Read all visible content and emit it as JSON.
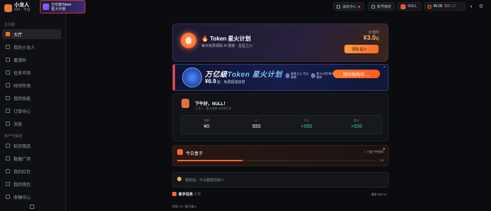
{
  "sidebar": {
    "brand_name": "小龙人",
    "brand_sub": "#24 · 平台",
    "promo_line1": "万亿级Token",
    "promo_line2": "星火计划",
    "section_main": "主功能",
    "section_assets": "资产与渠道",
    "items": [
      {
        "label": "大厅"
      },
      {
        "label": "我的小龙人"
      },
      {
        "label": "邀请码"
      },
      {
        "label": "任务市场"
      },
      {
        "label": "时间市场"
      },
      {
        "label": "我的技能"
      },
      {
        "label": "订单中心"
      },
      {
        "label": "消息"
      },
      {
        "label": "知识商店"
      },
      {
        "label": "数据广场"
      },
      {
        "label": "我的红包"
      },
      {
        "label": "我的钱包"
      },
      {
        "label": "收稿中心"
      }
    ]
  },
  "topbar": {
    "messages": "消息中心",
    "bind": "账号绑定",
    "user": "NULL",
    "balance": "¥0.00",
    "tokens": "555",
    "tokens_unit": "UT"
  },
  "token_card": {
    "title": "🔥 Token 星火计划",
    "subtitle": "每日免费领取 AI 额度 · 星星之火",
    "price_label": "价值约",
    "price": "¥3.0",
    "price_unit": "起",
    "button": "领取 星火 →"
  },
  "banner": {
    "title_a": "万亿级",
    "title_b": "Token 星火计划",
    "price": "¥6.9",
    "price_tail": "起 · 免费超值加倍",
    "chip1": "星星之火 可以燎原",
    "chip2": "星火计划 每天都有",
    "button": "限时抢购中 →",
    "close": "×"
  },
  "greeting": {
    "title": "下午好，NULL！",
    "subtitle": "小龙人 · 星火燎原计划进行中",
    "stats": [
      {
        "label": "余额",
        "value": "¥0",
        "green": false
      },
      {
        "label": "UT",
        "value": "555",
        "unit": "UT",
        "green": false
      },
      {
        "label": "今日",
        "value": "+555",
        "green": true
      },
      {
        "label": "累计",
        "value": "+555",
        "green": true
      }
    ]
  },
  "box": {
    "title": "今日盒子",
    "meta": "1 个盒子待领取",
    "count": "1/3",
    "progress": 0.33
  },
  "ask": {
    "placeholder": "我知道，什么都能找到人"
  },
  "tasks": {
    "title": "新手任务",
    "subtitle": "引导",
    "reward": "最多 800 UT",
    "progress_text": "完成 1/3 · 能力接入"
  }
}
